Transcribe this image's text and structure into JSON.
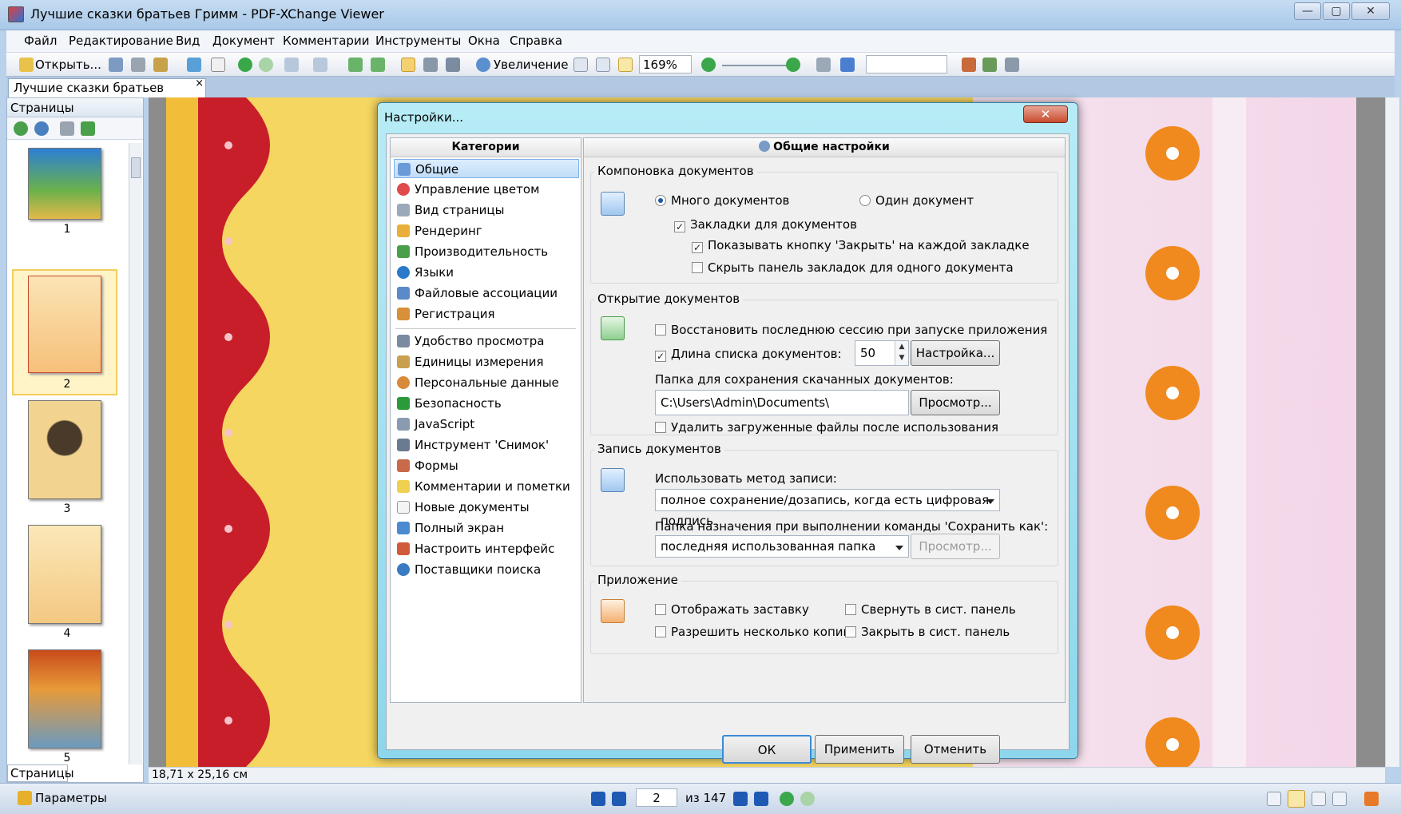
{
  "window": {
    "title": "Лучшие сказки братьев Гримм - PDF-XChange Viewer",
    "min": "—",
    "max": "▢",
    "close": "✕"
  },
  "menu": [
    "Файл",
    "Редактирование",
    "Вид",
    "Документ",
    "Комментарии",
    "Инструменты",
    "Окна",
    "Справка"
  ],
  "toolbar": {
    "open_label": "Открыть...",
    "zoom_tool_label": "Увеличение",
    "zoom_value": "169%",
    "search_value": ""
  },
  "doc_tab": {
    "label": "Лучшие сказки братьев Гримм",
    "close": "×"
  },
  "pages_pane": {
    "title": "Страницы",
    "bottom_tab": "Страницы",
    "thumbs": [
      "1",
      "2",
      "3",
      "4",
      "5"
    ],
    "selected": "2"
  },
  "doc": {
    "size_readout": "18,71 x 25,16 см"
  },
  "status": {
    "params_label": "Параметры",
    "page_value": "2",
    "page_total": "из 147"
  },
  "dialog": {
    "title": "Настройки...",
    "close": "✕",
    "categories_header": "Категории",
    "categories_group1": [
      "Общие",
      "Управление цветом",
      "Вид страницы",
      "Рендеринг",
      "Производительность",
      "Языки",
      "Файловые ассоциации",
      "Регистрация"
    ],
    "categories_group2": [
      "Удобство просмотра",
      "Единицы измерения",
      "Персональные данные",
      "Безопасность",
      "JavaScript",
      "Инструмент 'Снимок'",
      "Формы",
      "Комментарии и пометки",
      "Новые документы",
      "Полный экран",
      "Настроить интерфейс",
      "Поставщики поиска"
    ],
    "selected_category": "Общие",
    "settings_header": "Общие настройки",
    "layout_group": {
      "title": "Компоновка документов",
      "many_docs": "Много документов",
      "one_doc": "Один документ",
      "tabs": "Закладки для документов",
      "show_close": "Показывать кнопку 'Закрыть' на каждой закладке",
      "hide_tabbar": "Скрыть панель закладок для одного документа"
    },
    "open_group": {
      "title": "Открытие документов",
      "restore": "Восстановить последнюю сессию при запуске приложения",
      "list_len": "Длина списка документов:",
      "list_len_value": "50",
      "configure_btn": "Настройка...",
      "download_folder_label": "Папка для сохранения скачанных документов:",
      "download_folder_value": "C:\\Users\\Admin\\Documents\\",
      "browse_btn": "Просмотр...",
      "delete_downloaded": "Удалить загруженные файлы после использования"
    },
    "save_group": {
      "title": "Запись документов",
      "method_label": "Использовать метод записи:",
      "method_value": "полное сохранение/дозапись, когда есть цифровая подпись",
      "saveas_label": "Папка назначения при выполнении команды 'Сохранить как':",
      "saveas_value": "последняя использованная папка",
      "browse_btn": "Просмотр..."
    },
    "app_group": {
      "title": "Приложение",
      "splash": "Отображать заставку",
      "multi": "Разрешить несколько копий",
      "minimize_tray": "Свернуть в сист. панель",
      "close_tray": "Закрыть в сист. панель"
    },
    "ok": "ОК",
    "apply": "Применить",
    "cancel": "Отменить"
  },
  "colors": {
    "accent": "#3c8ad6",
    "dialog_frame": "#8dd6ec",
    "page_red": "#c81e2a",
    "page_orange": "#f08a1e"
  }
}
